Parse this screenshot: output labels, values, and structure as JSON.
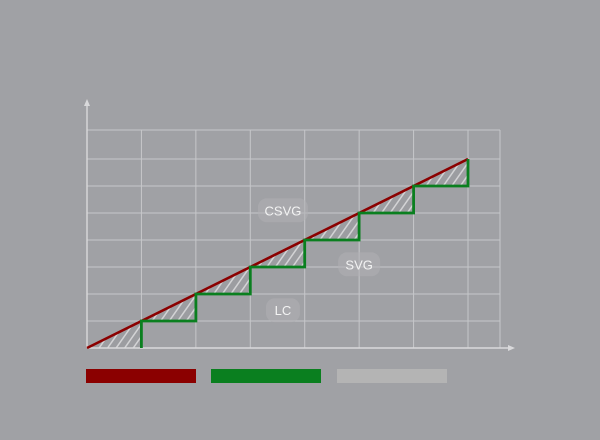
{
  "chart_data": {
    "type": "line",
    "x": [
      0,
      1,
      2,
      3,
      4,
      5,
      6,
      7
    ],
    "xlim": [
      0,
      7.8
    ],
    "ylim": [
      0,
      7.2
    ],
    "grid": true,
    "series": [
      {
        "key": "target",
        "color": "#8b0000",
        "style": "straight",
        "x": [
          0,
          7
        ],
        "y": [
          0,
          7
        ]
      },
      {
        "key": "steps",
        "color": "#0a7f1f",
        "style": "staircase",
        "x": [
          1,
          1,
          2,
          2,
          3,
          3,
          4,
          4,
          5,
          5,
          6,
          6,
          7,
          7
        ],
        "y": [
          0,
          1,
          1,
          2,
          2,
          3,
          3,
          4,
          4,
          5,
          5,
          6,
          6,
          7
        ]
      }
    ],
    "annotations": [
      {
        "text": "CSVG",
        "x": 3.6,
        "y": 5.1
      },
      {
        "text": "SVG",
        "x": 5.0,
        "y": 3.1
      },
      {
        "text": "LC",
        "x": 3.6,
        "y": 1.4
      }
    ],
    "legend_swatches": [
      {
        "color": "#8b0000"
      },
      {
        "color": "#0a7f1f"
      },
      {
        "color": "#b4b4b4"
      }
    ],
    "colors": {
      "background": "#a0a1a5",
      "grid": "#c6c7ca",
      "hatch": "#d4d4d6"
    }
  }
}
